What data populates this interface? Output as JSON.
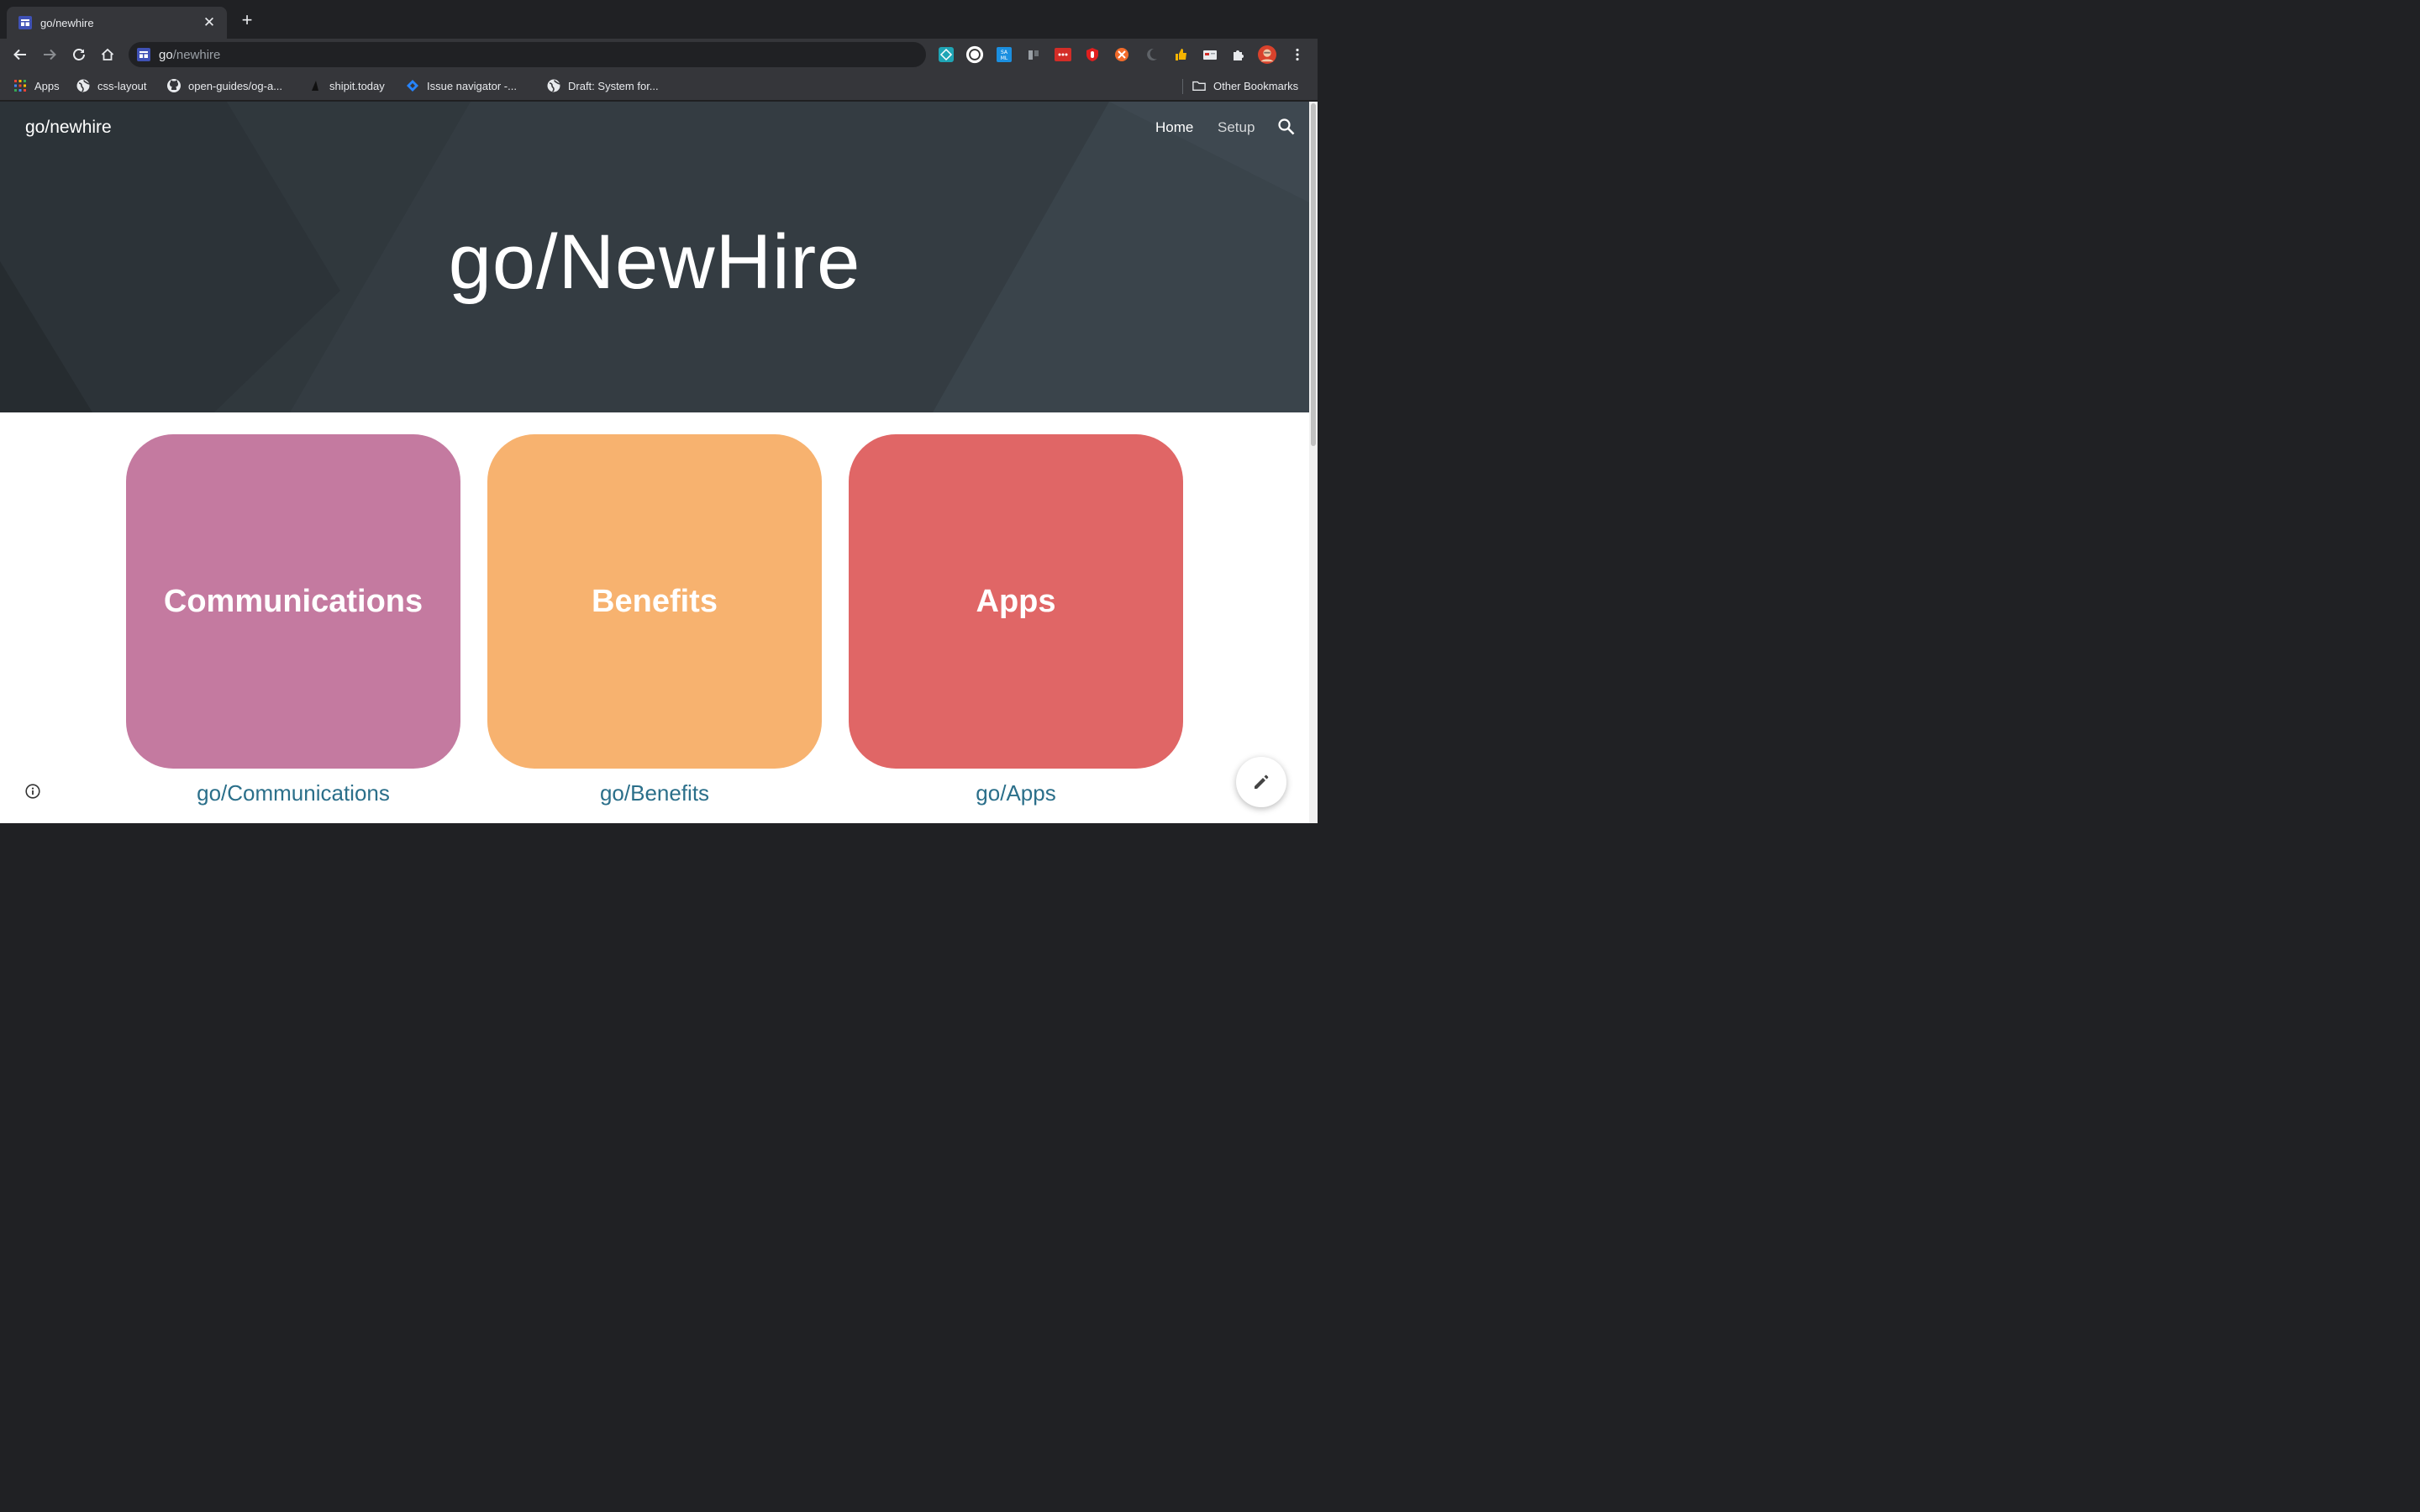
{
  "browser": {
    "tab": {
      "title": "go/newhire"
    },
    "omnibox": {
      "host": "go",
      "path": "/newhire"
    },
    "bookmarks": [
      {
        "label": "Apps",
        "icon": "apps-grid-icon"
      },
      {
        "label": "css-layout",
        "icon": "globe-icon"
      },
      {
        "label": "open-guides/og-a...",
        "icon": "github-icon"
      },
      {
        "label": "shipit.today",
        "icon": "sail-icon"
      },
      {
        "label": "Issue navigator -...",
        "icon": "jira-icon"
      },
      {
        "label": "Draft: System for...",
        "icon": "globe-icon"
      }
    ],
    "other_bookmarks": "Other Bookmarks"
  },
  "site": {
    "title": "go/newhire",
    "nav": {
      "home": "Home",
      "setup": "Setup"
    },
    "hero_title": "go/NewHire",
    "cards": [
      {
        "label": "Communications",
        "link": "go/Communications",
        "color": "#c47aa0"
      },
      {
        "label": "Benefits",
        "link": "go/Benefits",
        "color": "#f7b26f"
      },
      {
        "label": "Apps",
        "link": "go/Apps",
        "color": "#e06666"
      }
    ]
  }
}
